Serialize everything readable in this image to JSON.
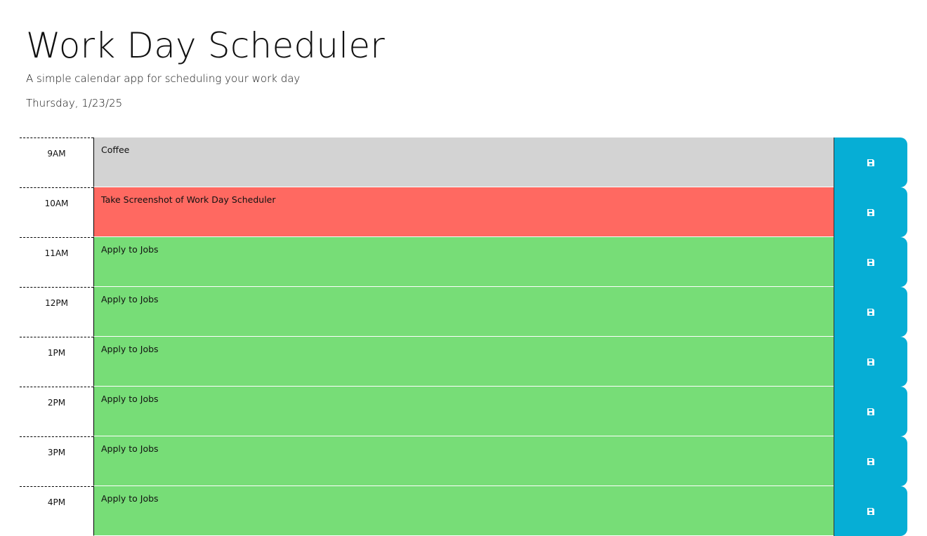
{
  "header": {
    "title": "Work Day Scheduler",
    "lead": "A simple calendar app for scheduling your work day",
    "current_day": "Thursday, 1/23/25"
  },
  "colors": {
    "past": "#d3d3d3",
    "present": "#ff6961",
    "future": "#77dd77",
    "save_button": "#06aed5"
  },
  "rows": [
    {
      "hour": "9AM",
      "text": "Coffee",
      "status": "past",
      "icon": "save-icon"
    },
    {
      "hour": "10AM",
      "text": "Take Screenshot of Work Day Scheduler",
      "status": "present",
      "icon": "save-icon"
    },
    {
      "hour": "11AM",
      "text": "Apply to Jobs",
      "status": "future",
      "icon": "save-icon"
    },
    {
      "hour": "12PM",
      "text": "Apply to Jobs",
      "status": "future",
      "icon": "save-icon"
    },
    {
      "hour": "1PM",
      "text": "Apply to Jobs",
      "status": "future",
      "icon": "save-icon"
    },
    {
      "hour": "2PM",
      "text": "Apply to Jobs",
      "status": "future",
      "icon": "save-icon"
    },
    {
      "hour": "3PM",
      "text": "Apply to Jobs",
      "status": "future",
      "icon": "save-icon"
    },
    {
      "hour": "4PM",
      "text": "Apply to Jobs",
      "status": "future",
      "icon": "save-icon"
    }
  ]
}
